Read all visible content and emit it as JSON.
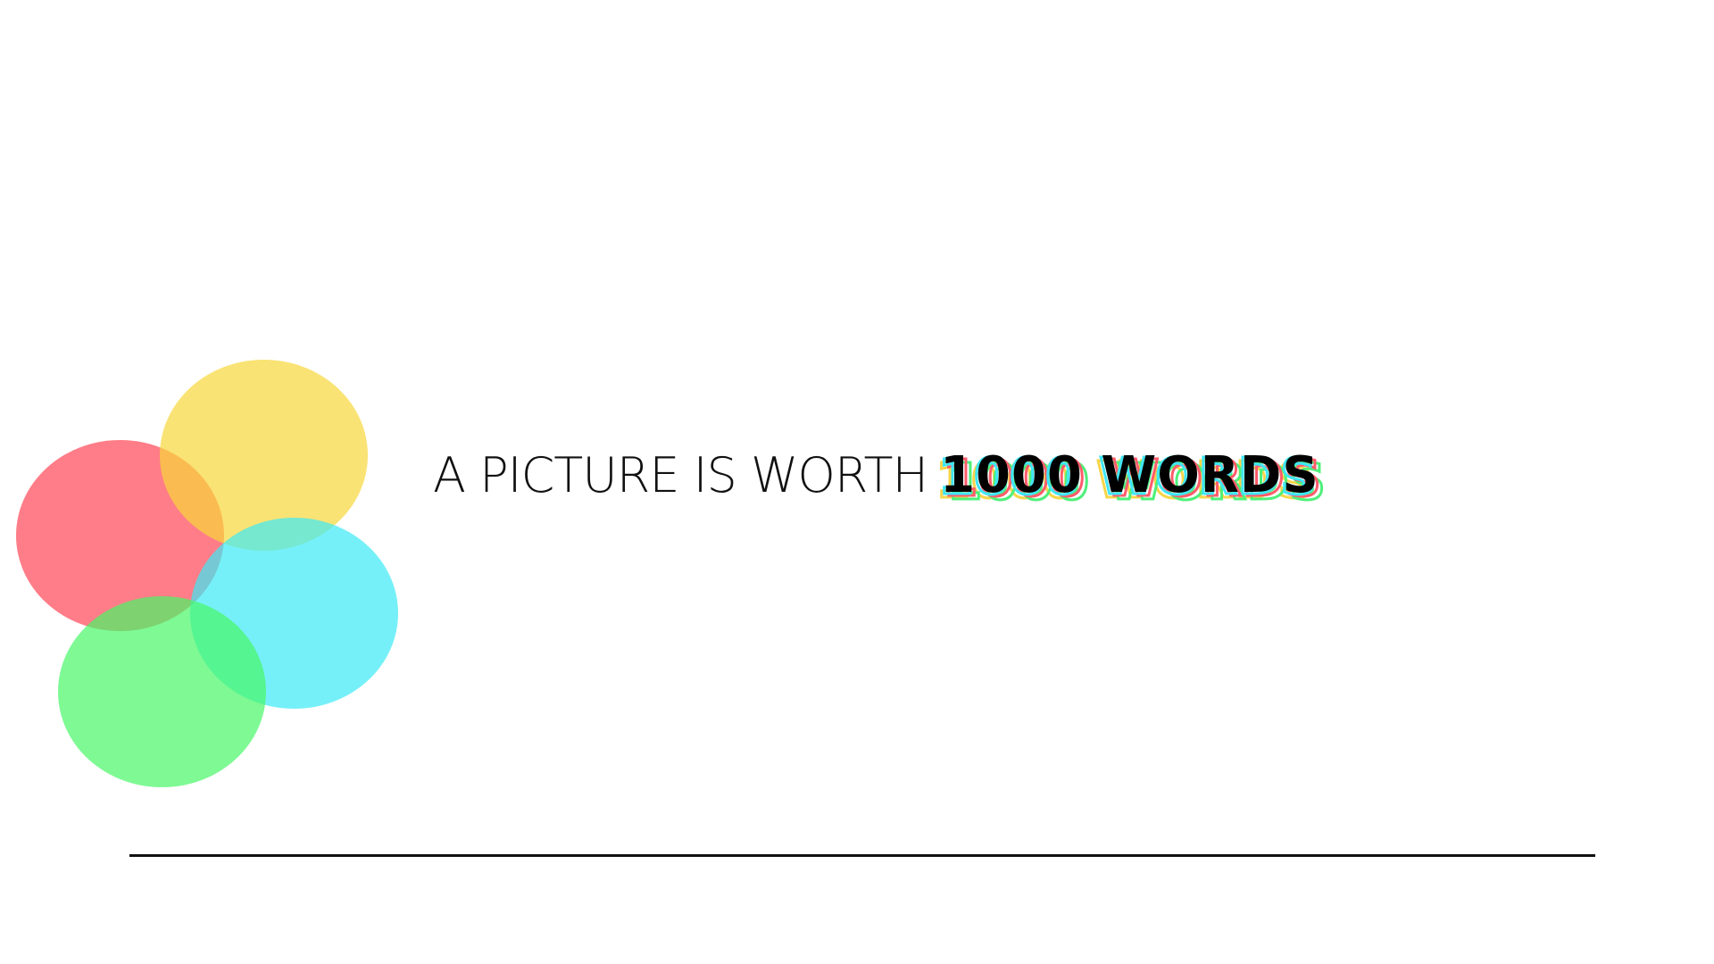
{
  "headline": {
    "lead": "A PICTURE IS WORTH",
    "accent": "1000 WORDS"
  },
  "colors": {
    "red": "#ff4655",
    "yellow": "#f8d73a",
    "cyan": "#3ceaf5",
    "green": "#47f766",
    "text": "#111111",
    "divider": "#111111"
  }
}
